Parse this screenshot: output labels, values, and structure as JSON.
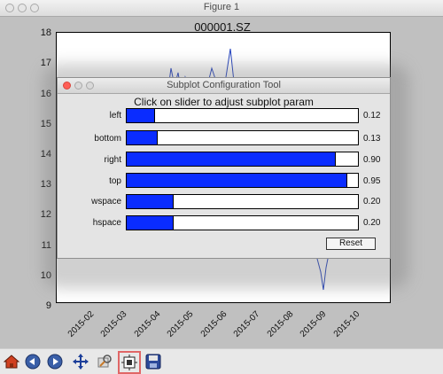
{
  "window": {
    "title": "Figure 1"
  },
  "plot": {
    "title": "000001.SZ",
    "y_ticks": [
      "18",
      "17",
      "16",
      "15",
      "14",
      "13",
      "12",
      "11",
      "10",
      "9"
    ],
    "x_ticks": [
      "2015-02",
      "2015-03",
      "2015-04",
      "2015-05",
      "2015-06",
      "2015-07",
      "2015-08",
      "2015-09",
      "2015-10"
    ]
  },
  "dialog": {
    "title": "Subplot Configuration Tool",
    "heading": "Click on slider to adjust subplot param",
    "sliders": [
      {
        "label": "left",
        "value": 0.12,
        "value_text": "0.12"
      },
      {
        "label": "bottom",
        "value": 0.13,
        "value_text": "0.13"
      },
      {
        "label": "right",
        "value": 0.9,
        "value_text": "0.90"
      },
      {
        "label": "top",
        "value": 0.95,
        "value_text": "0.95"
      },
      {
        "label": "wspace",
        "value": 0.2,
        "value_text": "0.20"
      },
      {
        "label": "hspace",
        "value": 0.2,
        "value_text": "0.20"
      }
    ],
    "reset_label": "Reset"
  },
  "toolbar": {
    "buttons": [
      "home-icon",
      "back-icon",
      "forward-icon",
      "pan-icon",
      "zoom-icon",
      "subplots-icon",
      "save-icon"
    ],
    "active": "subplots-icon"
  },
  "colors": {
    "slider_fill": "#0a2cff",
    "line": "#1f3fbf"
  }
}
